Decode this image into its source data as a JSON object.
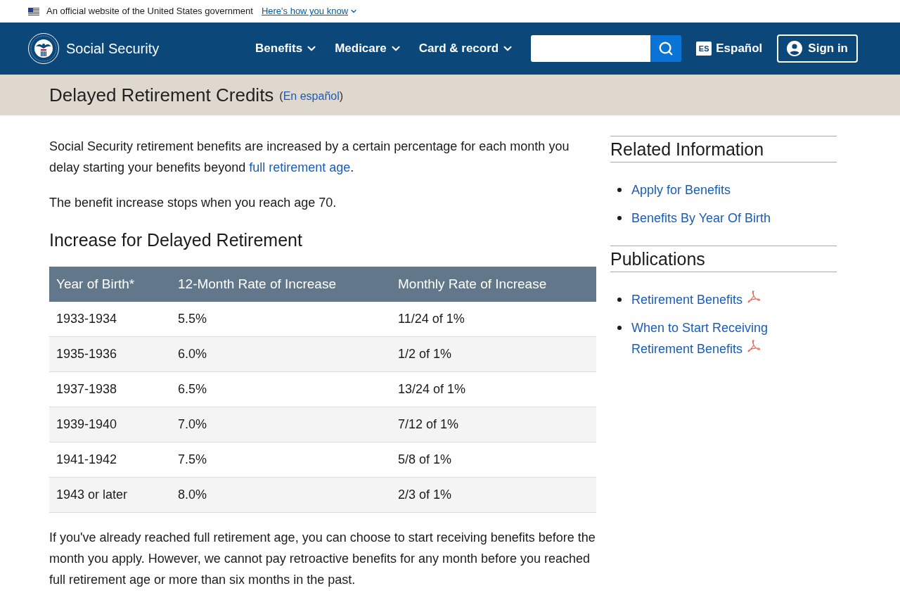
{
  "gov_banner": {
    "text": "An official website of the United States government",
    "link": "Here's how you know"
  },
  "header": {
    "site_name": "Social Security",
    "nav": [
      {
        "label": "Benefits"
      },
      {
        "label": "Medicare"
      },
      {
        "label": "Card & record"
      }
    ],
    "language_link": {
      "badge": "ES",
      "label": "Español"
    },
    "sign_in": "Sign in"
  },
  "title_band": {
    "title": "Delayed Retirement Credits",
    "language_note": {
      "open": "(",
      "link": "En español",
      "close": ")"
    }
  },
  "main": {
    "content": [
      {
        "kind": "paragraph",
        "parts": [
          {
            "kind": "text",
            "text": "Social Security retirement benefits are increased by a certain percentage for each month you delay starting your benefits beyond "
          },
          {
            "kind": "link",
            "text": "full retirement age"
          },
          {
            "kind": "text",
            "text": "."
          }
        ]
      },
      {
        "kind": "paragraph",
        "parts": [
          {
            "kind": "text",
            "text": "The benefit increase stops when you reach age 70."
          }
        ]
      },
      {
        "kind": "heading",
        "text": "Increase for Delayed Retirement"
      },
      {
        "kind": "table",
        "columns": [
          "Year of Birth*",
          "12-Month Rate of Increase",
          "Monthly Rate of Increase"
        ],
        "rows": [
          [
            "1933-1934",
            "5.5%",
            "11/24 of 1%"
          ],
          [
            "1935-1936",
            "6.0%",
            "1/2 of 1%"
          ],
          [
            "1937-1938",
            "6.5%",
            "13/24 of 1%"
          ],
          [
            "1939-1940",
            "7.0%",
            "7/12 of 1%"
          ],
          [
            "1941-1942",
            "7.5%",
            "5/8 of 1%"
          ],
          [
            "1943 or later",
            "8.0%",
            "2/3 of 1%"
          ]
        ]
      },
      {
        "kind": "paragraph",
        "parts": [
          {
            "kind": "text",
            "text": "If you've already reached full retirement age, you can choose to start receiving benefits before the month you apply. However, we cannot pay retroactive benefits for any month before you reached full retirement age or more than six months in the past."
          }
        ]
      }
    ]
  },
  "sidebar": {
    "sections": [
      {
        "heading": "Related Information",
        "links": [
          {
            "label": "Apply for Benefits",
            "kind": "page"
          },
          {
            "label": "Benefits By Year Of Birth",
            "kind": "page"
          }
        ]
      },
      {
        "heading": "Publications",
        "links": [
          {
            "label": "Retirement Benefits",
            "kind": "pdf"
          },
          {
            "label": "When to Start Receiving Retirement Benefits",
            "kind": "pdf"
          }
        ]
      }
    ]
  }
}
